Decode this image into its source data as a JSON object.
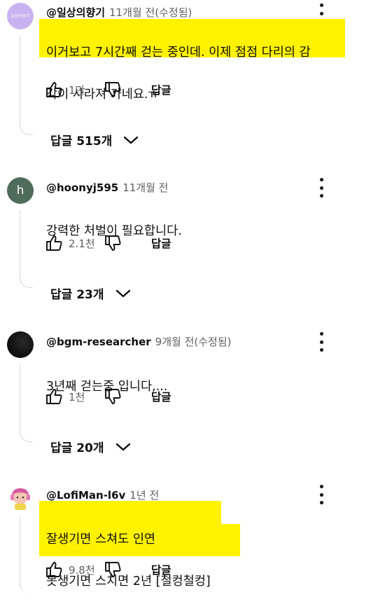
{
  "colors": {
    "highlight": "#fff200",
    "text": "#0f0f0f",
    "meta": "#606060"
  },
  "comments": [
    {
      "author": "@일상의향기",
      "meta": "11개월 전(수정됨)",
      "avatar_text": "일상의향기",
      "text_line1": "이거보고 7시간째  걷는 중인데. 이제 점점 다리의 감",
      "text_line2": "각이 사라져 가네요.ㅠ",
      "likes": "1만",
      "reply_label": "답글",
      "replies_toggle": "답글 515개",
      "highlighted": true
    },
    {
      "author": "@hoonyj595",
      "meta": "11개월 전",
      "avatar_letter": "h",
      "text_line1": "강력한 처벌이 필요합니다.",
      "likes": "2.1천",
      "reply_label": "답글",
      "replies_toggle": "답글 23개",
      "highlighted": false
    },
    {
      "author": "@bgm-researcher",
      "meta": "9개월 전(수정됨)",
      "text_line1": "3년째 걷는중 입니다,...",
      "likes": "1천",
      "reply_label": "답글",
      "replies_toggle": "답글 20개",
      "highlighted": false
    },
    {
      "author": "@LofiMan-l6v",
      "meta": "1년 전",
      "text_line1": "잘생기면 스쳐도 인연",
      "text_line2": "못생기면 스치면 2년 [철컹철컹]",
      "likes": "9.8천",
      "reply_label": "답글",
      "highlighted": true
    }
  ],
  "icons": [
    "like-icon",
    "dislike-icon",
    "more-vert-icon",
    "chevron-down-icon"
  ]
}
